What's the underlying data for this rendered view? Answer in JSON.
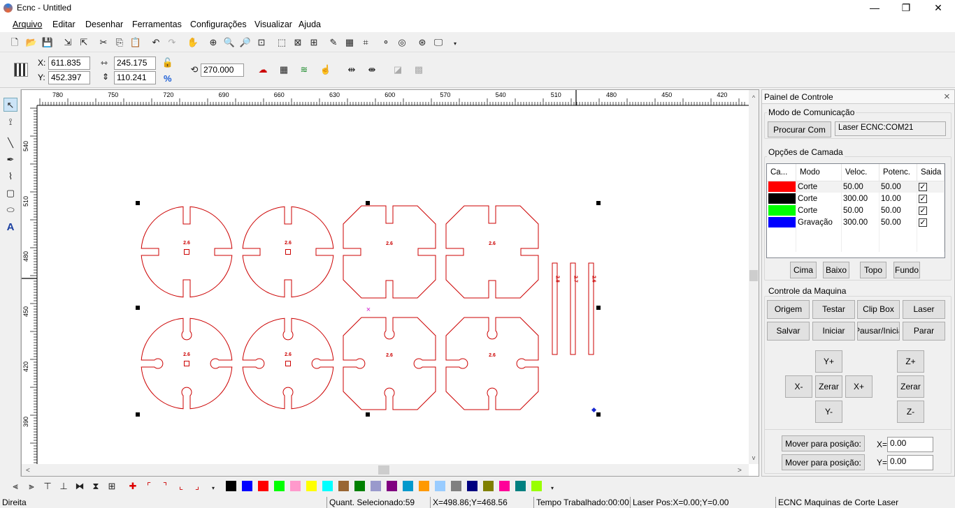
{
  "window": {
    "title": "Ecnc - Untitled",
    "min": "—",
    "max": "❐",
    "close": "✕"
  },
  "menu": [
    "Arquivo",
    "Editar",
    "Desenhar",
    "Ferramentas",
    "Configurações",
    "Visualizar",
    "Ajuda"
  ],
  "props": {
    "x_label": "X:",
    "x_value": "611.835",
    "y_label": "Y:",
    "y_value": "452.397",
    "w_value": "245.175",
    "h_value": "110.241",
    "percent": "%",
    "rotation": "270.000"
  },
  "ruler": {
    "top_ticks": [
      "780",
      "750",
      "720",
      "690",
      "660",
      "630",
      "600",
      "570",
      "540",
      "510",
      "480",
      "450",
      "420"
    ],
    "left_ticks": [
      "540",
      "510",
      "480",
      "450",
      "420",
      "390"
    ]
  },
  "shapes": {
    "labels": [
      "2.6",
      "2.6",
      "2.6",
      "2.6",
      "2.6",
      "2.6",
      "2.6",
      "2.6"
    ],
    "strip_labels": [
      "2.8",
      "2.7",
      "2.6"
    ]
  },
  "panel": {
    "title": "Painel de Controle",
    "close": "×",
    "comm_title": "Modo de Comunicação",
    "search_btn": "Procurar Com",
    "port_value": "Laser ECNC:COM21",
    "layer_title": "Opções de Camada",
    "columns": [
      "Ca...",
      "Modo",
      "Veloc.",
      "Potenc.",
      "Saida"
    ],
    "layers": [
      {
        "color": "#ff0000",
        "mode": "Corte",
        "speed": "50.00",
        "power": "50.00",
        "out": "✓"
      },
      {
        "color": "#000000",
        "mode": "Corte",
        "speed": "300.00",
        "power": "10.00",
        "out": "✓"
      },
      {
        "color": "#00ff00",
        "mode": "Corte",
        "speed": "50.00",
        "power": "50.00",
        "out": "✓"
      },
      {
        "color": "#0000ff",
        "mode": "Gravação",
        "speed": "300.00",
        "power": "50.00",
        "out": "✓"
      }
    ],
    "order_btns": [
      "Cima",
      "Baixo",
      "Topo",
      "Fundo"
    ],
    "machine_title": "Controle da Maquina",
    "machine_btns": [
      "Origem",
      "Testar",
      "Clip Box",
      "Laser",
      "Salvar",
      "Iniciar",
      "Pausar/Iniciar",
      "Parar"
    ],
    "jog": {
      "yplus": "Y+",
      "yminus": "Y-",
      "xminus": "X-",
      "xplus": "X+",
      "zero": "Zerar",
      "zplus": "Z+",
      "zzero": "Zerar",
      "zminus": "Z-"
    },
    "move_btn": "Mover para posição:",
    "move_x_label": "X=",
    "move_x": "0.00",
    "move_y_label": "Y=",
    "move_y": "0.00"
  },
  "palette": [
    "#000000",
    "#0000ff",
    "#ff0000",
    "#00ff00",
    "#ff99cc",
    "#ffff00",
    "#00ffff",
    "#996633",
    "#008000",
    "#9999cc",
    "#800080",
    "#0099cc",
    "#ff9900",
    "#99ccff",
    "#808080",
    "#000080",
    "#808000",
    "#ff0099",
    "#008080",
    "#99ff00"
  ],
  "status": {
    "mode": "Direita",
    "selected": "Quant. Selecionado:59",
    "coords": "X=498.86;Y=468.56",
    "time": "Tempo Trabalhado:00:00:",
    "laser": "Laser Pos:X=0.00;Y=0.00",
    "brand": "ECNC Maquinas de Corte Laser"
  }
}
